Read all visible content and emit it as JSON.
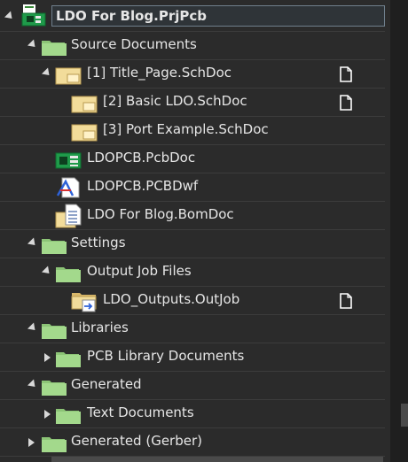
{
  "tree": {
    "project": {
      "label": "LDO For Blog.PrjPcb",
      "icon": "pcb-project-icon",
      "expanded": true
    },
    "items": [
      {
        "id": "source-documents",
        "label": "Source Documents",
        "level": 1,
        "type": "folder",
        "expanded": true
      },
      {
        "id": "title-page",
        "label": "[1] Title_Page.SchDoc",
        "level": 2,
        "type": "schdoc",
        "expanded": true,
        "page_icon": true
      },
      {
        "id": "basic-ldo",
        "label": "[2] Basic LDO.SchDoc",
        "level": 3,
        "type": "schdoc",
        "page_icon": true
      },
      {
        "id": "port-example",
        "label": "[3] Port Example.SchDoc",
        "level": 3,
        "type": "schdoc"
      },
      {
        "id": "ldopcb-pcbdoc",
        "label": "LDOPCB.PcbDoc",
        "level": 2,
        "type": "pcbdoc"
      },
      {
        "id": "ldopcb-pcbdwf",
        "label": "LDOPCB.PCBDwf",
        "level": 2,
        "type": "pcbdwf"
      },
      {
        "id": "bomdoc",
        "label": "LDO For Blog.BomDoc",
        "level": 2,
        "type": "bomdoc"
      },
      {
        "id": "settings",
        "label": "Settings",
        "level": 1,
        "type": "folder",
        "expanded": true
      },
      {
        "id": "output-job-files",
        "label": "Output Job Files",
        "level": 2,
        "type": "folder",
        "expanded": true
      },
      {
        "id": "outjob",
        "label": "LDO_Outputs.OutJob",
        "level": 3,
        "type": "outjob",
        "page_icon": true
      },
      {
        "id": "libraries",
        "label": "Libraries",
        "level": 1,
        "type": "folder",
        "expanded": true
      },
      {
        "id": "pcb-library-documents",
        "label": "PCB Library Documents",
        "level": 2,
        "type": "folder",
        "expanded": false
      },
      {
        "id": "generated",
        "label": "Generated",
        "level": 1,
        "type": "folder",
        "expanded": true
      },
      {
        "id": "text-documents",
        "label": "Text Documents",
        "level": 2,
        "type": "folder",
        "expanded": false
      },
      {
        "id": "generated-gerber",
        "label": "Generated (Gerber)",
        "level": 1,
        "type": "folder",
        "expanded": false
      }
    ]
  },
  "colors": {
    "folder": "#a3d98c",
    "folder_dark": "#8cc476",
    "schdoc": "#f2dc9a",
    "background": "#2b2b2b",
    "selection_border": "#6f7f8c"
  }
}
